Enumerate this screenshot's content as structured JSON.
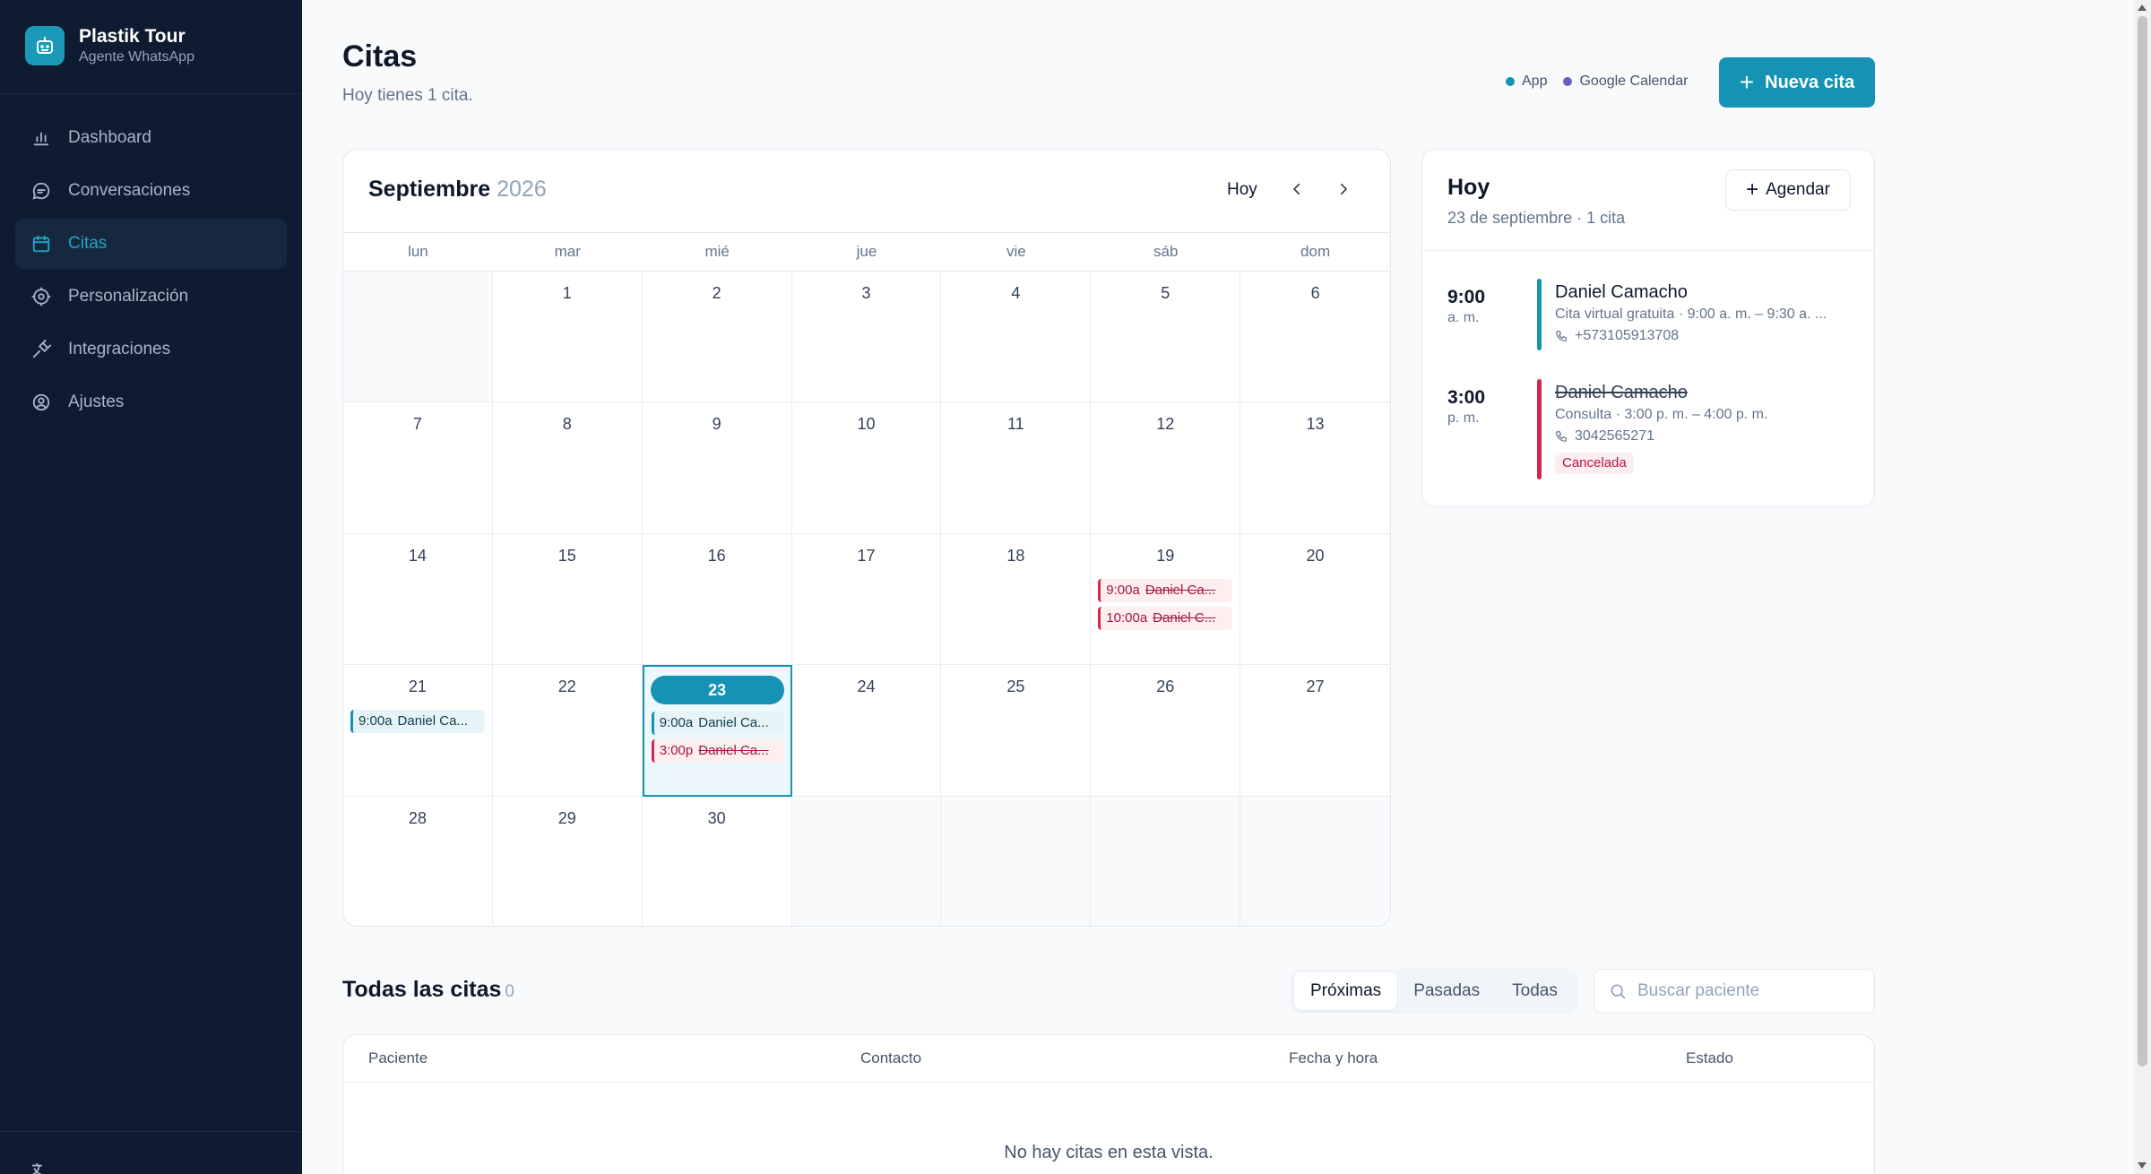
{
  "brand": {
    "name": "Plastik Tour",
    "subtitle": "Agente WhatsApp"
  },
  "nav": [
    {
      "label": "Dashboard",
      "icon": "chart-icon",
      "active": false
    },
    {
      "label": "Conversaciones",
      "icon": "chat-icon",
      "active": false
    },
    {
      "label": "Citas",
      "icon": "calendar-icon",
      "active": true
    },
    {
      "label": "Personalización",
      "icon": "gear-icon",
      "active": false
    },
    {
      "label": "Integraciones",
      "icon": "plug-icon",
      "active": false
    },
    {
      "label": "Ajustes",
      "icon": "user-circle-icon",
      "active": false
    }
  ],
  "header": {
    "title": "Citas",
    "subtitle": "Hoy tienes 1 cita.",
    "legend": [
      {
        "label": "App",
        "color": "#1592b4"
      },
      {
        "label": "Google Calendar",
        "color": "#6d5bc6"
      }
    ],
    "new_button": "Nueva cita"
  },
  "calendar": {
    "month": "Septiembre",
    "year": "2026",
    "today_button": "Hoy",
    "weekdays": [
      "lun",
      "mar",
      "mié",
      "jue",
      "vie",
      "sáb",
      "dom"
    ],
    "cells": [
      {
        "day": ""
      },
      {
        "day": "1"
      },
      {
        "day": "2"
      },
      {
        "day": "3"
      },
      {
        "day": "4"
      },
      {
        "day": "5"
      },
      {
        "day": "6"
      },
      {
        "day": "7"
      },
      {
        "day": "8"
      },
      {
        "day": "9"
      },
      {
        "day": "10"
      },
      {
        "day": "11"
      },
      {
        "day": "12"
      },
      {
        "day": "13"
      },
      {
        "day": "14"
      },
      {
        "day": "15"
      },
      {
        "day": "16"
      },
      {
        "day": "17"
      },
      {
        "day": "18"
      },
      {
        "day": "19",
        "events": [
          {
            "time": "9:00a",
            "name": "Daniel Ca...",
            "status": "cancel"
          },
          {
            "time": "10:00a",
            "name": "Daniel C...",
            "status": "cancel"
          }
        ]
      },
      {
        "day": "20"
      },
      {
        "day": "21",
        "events": [
          {
            "time": "9:00a",
            "name": "Daniel Ca...",
            "status": "ok"
          }
        ]
      },
      {
        "day": "22"
      },
      {
        "day": "23",
        "today": true,
        "events": [
          {
            "time": "9:00a",
            "name": "Daniel Ca...",
            "status": "ok"
          },
          {
            "time": "3:00p",
            "name": "Daniel Ca...",
            "status": "cancel"
          }
        ]
      },
      {
        "day": "24"
      },
      {
        "day": "25"
      },
      {
        "day": "26"
      },
      {
        "day": "27"
      },
      {
        "day": "28"
      },
      {
        "day": "29"
      },
      {
        "day": "30"
      },
      {
        "day": ""
      },
      {
        "day": ""
      },
      {
        "day": ""
      },
      {
        "day": ""
      }
    ],
    "colors": {
      "ok": "#1592b4",
      "cancel": "#d1284f"
    }
  },
  "today_panel": {
    "title": "Hoy",
    "subtitle": "23 de septiembre · 1 cita",
    "add_button": "Agendar",
    "appointments": [
      {
        "time": "9:00",
        "meridiem": "a. m.",
        "name": "Daniel Camacho",
        "detail": "Cita virtual gratuita · 9:00 a. m. – 9:30 a. ...",
        "phone": "+573105913708",
        "status": "ok"
      },
      {
        "time": "3:00",
        "meridiem": "p. m.",
        "name": "Daniel Camacho",
        "detail": "Consulta · 3:00 p. m. – 4:00 p. m.",
        "phone": "3042565271",
        "status": "cancel",
        "badge": "Cancelada"
      }
    ]
  },
  "all_appointments": {
    "title": "Todas las citas",
    "count": "0",
    "filters": [
      {
        "label": "Próximas",
        "active": true
      },
      {
        "label": "Pasadas",
        "active": false
      },
      {
        "label": "Todas",
        "active": false
      }
    ],
    "search_placeholder": "Buscar paciente",
    "columns": [
      "Paciente",
      "Contacto",
      "Fecha y hora",
      "Estado"
    ],
    "empty_message": "No hay citas en esta vista."
  }
}
